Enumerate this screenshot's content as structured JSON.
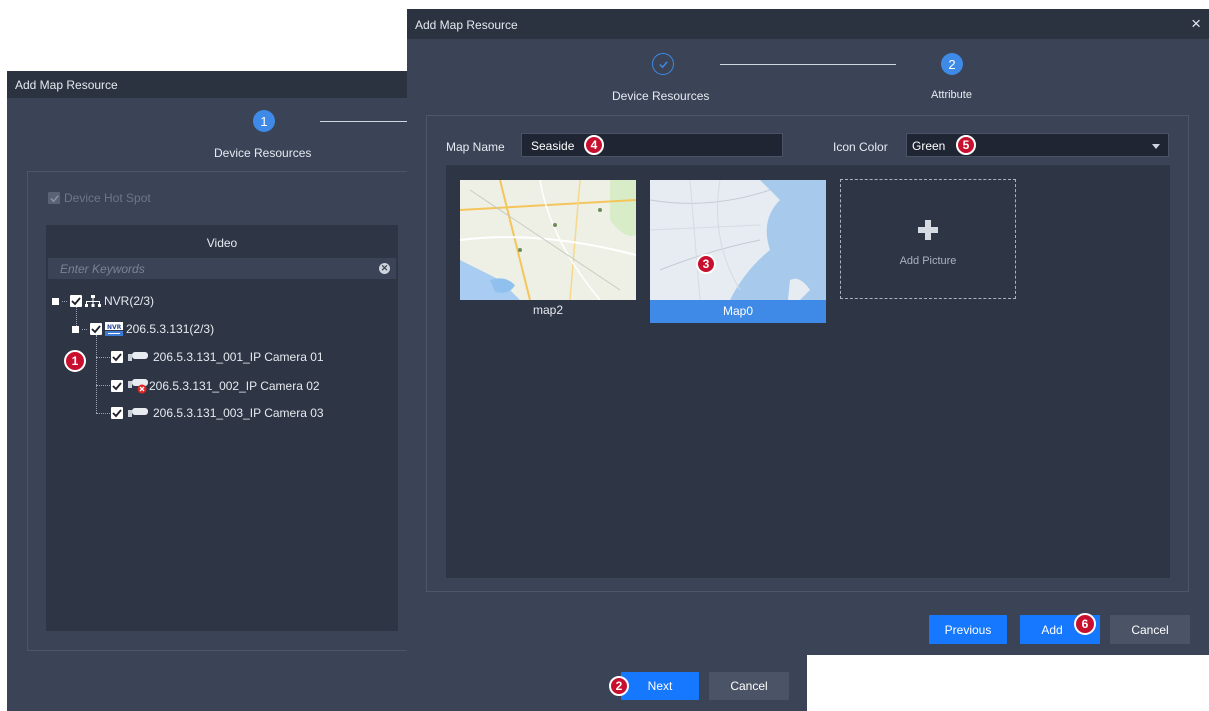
{
  "back_dialog": {
    "title": "Add Map Resource",
    "step1_number": "1",
    "step1_label": "Device Resources",
    "hot_spot_label": "Device Hot Spot",
    "video_header": "Video",
    "search_placeholder": "Enter Keywords",
    "tree": {
      "nvr": "NVR(2/3)",
      "device": "206.5.3.131(2/3)",
      "cameras": [
        "206.5.3.131_001_IP Camera 01",
        "206.5.3.131_002_IP Camera 02",
        "206.5.3.131_003_IP Camera 03"
      ]
    },
    "next_label": "Next",
    "cancel_label": "Cancel"
  },
  "front_dialog": {
    "title": "Add Map Resource",
    "close_glyph": "×",
    "step1_label": "Device Resources",
    "step2_number": "2",
    "step2_label": "Attribute",
    "map_name_label": "Map Name",
    "map_name_value": "Seaside",
    "icon_color_label": "Icon Color",
    "icon_color_value": "Green",
    "maps": [
      {
        "name": "map2",
        "selected": false
      },
      {
        "name": "Map0",
        "selected": true
      }
    ],
    "add_picture_label": "Add Picture",
    "previous_label": "Previous",
    "add_label": "Add",
    "cancel_label": "Cancel"
  },
  "callouts": [
    "1",
    "2",
    "3",
    "4",
    "5",
    "6"
  ],
  "colors": {
    "accent": "#1677ff",
    "dialog_bg": "#3b4457",
    "panel_bg": "#2e3544",
    "callout": "#c8102e"
  }
}
